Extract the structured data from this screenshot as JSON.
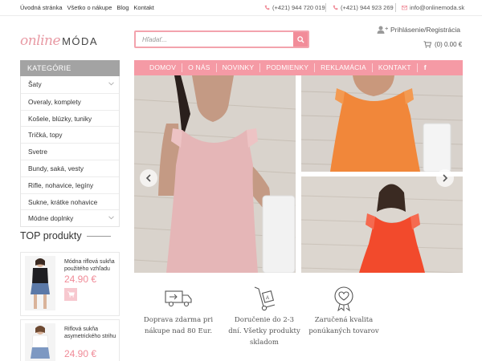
{
  "topbar": {
    "links": [
      "Úvodná stránka",
      "Všetko o nákupe",
      "Blog",
      "Kontakt"
    ],
    "phone1": "(+421) 944 720 019",
    "phone2": "(+421) 944 923 269",
    "email": "info@onlinemoda.sk"
  },
  "logo": {
    "script": "online",
    "word": "MÓDA"
  },
  "search": {
    "placeholder": "Hľadať..."
  },
  "header": {
    "login": "Prihlásenie/Registrácia",
    "cart": "(0) 0.00 €"
  },
  "sidebar": {
    "heading": "KATEGÓRIE",
    "categories": [
      "Šaty",
      "Overaly, komplety",
      "Košele, blúzky, tuniky",
      "Tričká, topy",
      "Svetre",
      "Bundy, saká, vesty",
      "Rifle, nohavice, legíny",
      "Sukne, krátke nohavice",
      "Módne doplnky"
    ],
    "top_heading": "TOP produkty",
    "products": [
      {
        "name": "Módna riflová sukňa použitého vzhľadu",
        "price": "24.90 €"
      },
      {
        "name": "Riflová sukňa asymetrického strihu",
        "price": "24.90 €"
      }
    ]
  },
  "nav": {
    "items": [
      "DOMOV",
      "O NÁS",
      "NOVINKY",
      "PODMIENKY",
      "REKLAMÁCIA",
      "KONTAKT"
    ]
  },
  "benefits": [
    {
      "icon": "delivery-truck-icon",
      "text": [
        "Doprava zdarma pri",
        "nákupe nad 80 Eur."
      ]
    },
    {
      "icon": "hand-truck-icon",
      "text": [
        "Doručenie do 2-3",
        "dní. Všetky produkty",
        "skladom"
      ]
    },
    {
      "icon": "heart-badge-icon",
      "text": [
        "Zaručená kvalita",
        "ponúkaných tovarov"
      ]
    }
  ],
  "colors": {
    "accent": "#f59aa5",
    "price": "#f08a97",
    "category_header": "#a3a3a3"
  }
}
